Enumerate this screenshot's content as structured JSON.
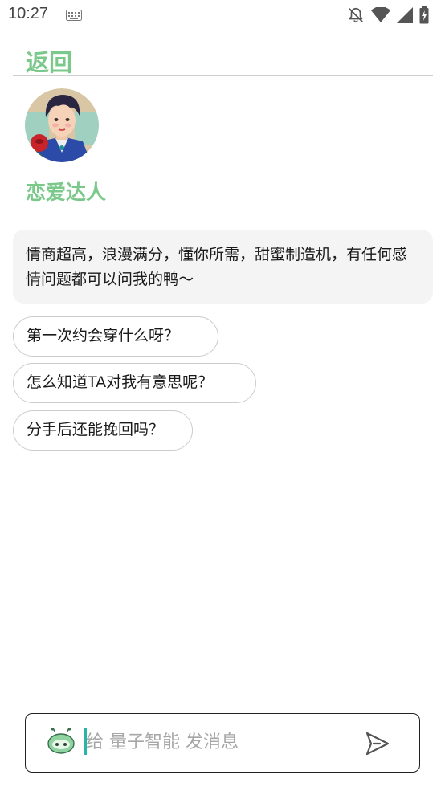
{
  "status_bar": {
    "time": "10:27",
    "icons": [
      "keyboard-icon",
      "notifications-off-icon",
      "wifi-icon",
      "signal-icon",
      "battery-charging-icon"
    ]
  },
  "header": {
    "back_label": "返回"
  },
  "profile": {
    "avatar_icon": "avatar-portrait",
    "name": "恋爱达人"
  },
  "intro": {
    "text": "情商超高，浪漫满分，懂你所需，甜蜜制造机，有任何感情问题都可以问我的鸭～"
  },
  "suggestions": [
    {
      "label": "第一次约会穿什么呀？"
    },
    {
      "label": "怎么知道TA对我有意思呢？"
    },
    {
      "label": "分手后还能挽回吗？"
    }
  ],
  "composer": {
    "placeholder": "给 量子智能 发消息",
    "bot_icon": "robot-icon",
    "send_icon": "send-icon"
  },
  "colors": {
    "accent": "#7bc88b",
    "caret": "#2ab3a6",
    "bubble_bg": "#f4f4f4"
  }
}
